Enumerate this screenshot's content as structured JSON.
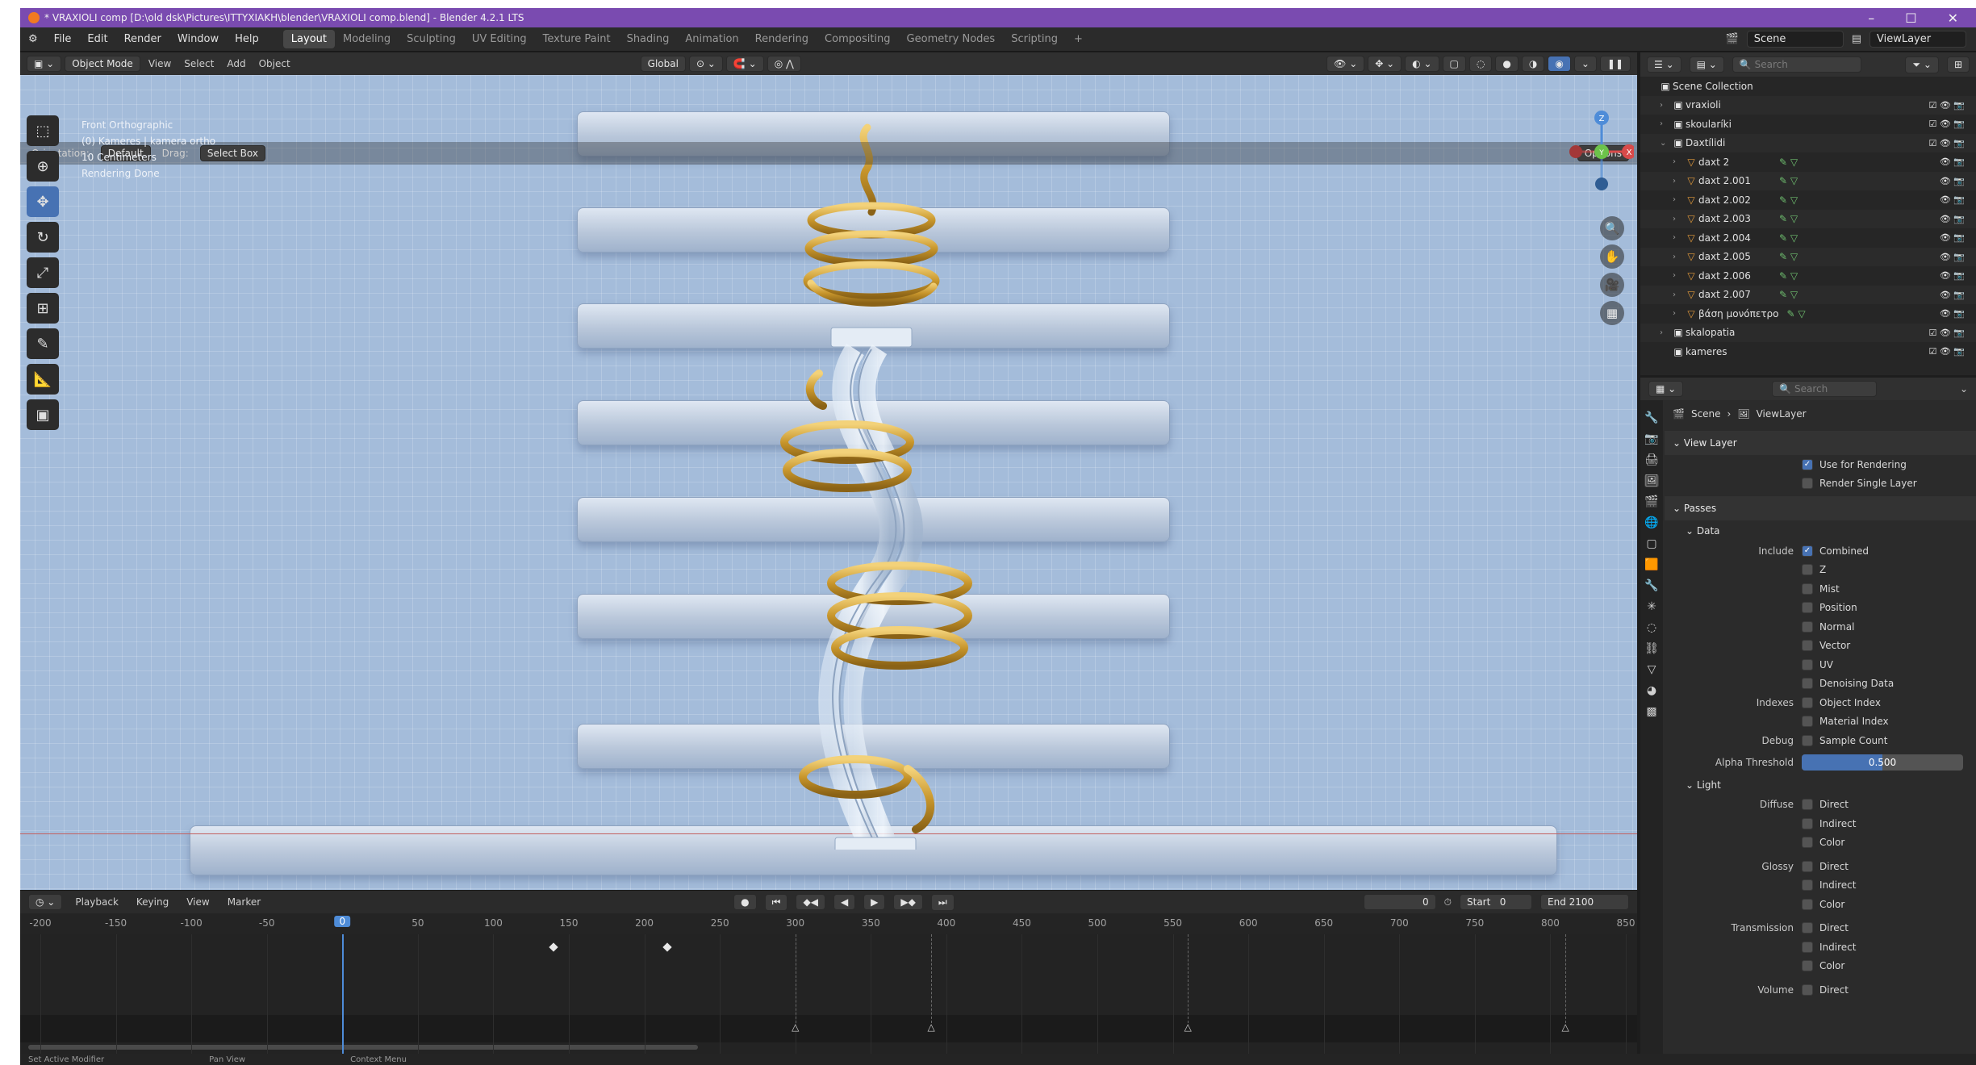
{
  "window": {
    "title": "* VRAXIOLI comp [D:\\old dsk\\Pictures\\ITTYXIAKH\\blender\\VRAXIOLI comp.blend] - Blender 4.2.1 LTS",
    "controls": [
      "–",
      "☐",
      "✕"
    ]
  },
  "menu": [
    "File",
    "Edit",
    "Render",
    "Window",
    "Help"
  ],
  "workspaces": [
    "Layout",
    "Modeling",
    "Sculpting",
    "UV Editing",
    "Texture Paint",
    "Shading",
    "Animation",
    "Rendering",
    "Compositing",
    "Geometry Nodes",
    "Scripting"
  ],
  "active_workspace": "Layout",
  "add_workspace": "+",
  "scene": {
    "label": "Scene",
    "view_layer": "ViewLayer"
  },
  "viewport": {
    "mode": "Object Mode",
    "menus": [
      "View",
      "Select",
      "Add",
      "Object"
    ],
    "transform": "Global",
    "orientation_label": "Orientation:",
    "orientation_value": "Default",
    "drag_label": "Drag:",
    "drag_value": "Select Box",
    "options": "Options",
    "info_lines": [
      "Front Orthographic",
      "(0) Kameres | kamera ortho",
      "10 Centimeters",
      "Rendering Done"
    ]
  },
  "gizmo": {
    "x": "X",
    "y": "Y",
    "z": "Z"
  },
  "timeline": {
    "menus": [
      "Playback",
      "Keying",
      "View",
      "Marker"
    ],
    "current_frame": "0",
    "start_label": "Start",
    "start": "0",
    "end_label": "End",
    "end": "2100",
    "current_frame_value": 0,
    "ticks": [
      "-200",
      "-150",
      "-100",
      "-50",
      "0",
      "50",
      "100",
      "150",
      "200",
      "250",
      "300",
      "350",
      "400",
      "450",
      "500",
      "550",
      "600",
      "650",
      "700",
      "750",
      "800",
      "850"
    ],
    "keyframes": [
      140,
      215
    ],
    "markers": [
      300,
      390,
      560,
      810
    ]
  },
  "statusbar": {
    "items": [
      "Set Active Modifier",
      "Pan View",
      "Context Menu"
    ]
  },
  "outliner": {
    "search_placeholder": "Search",
    "rows": [
      {
        "name": "Scene Collection",
        "level": 0,
        "icon": "collection",
        "expand": ""
      },
      {
        "name": "vraxioli",
        "level": 1,
        "icon": "collection",
        "expand": "›"
      },
      {
        "name": "skoularíki",
        "level": 1,
        "icon": "collection",
        "expand": "›"
      },
      {
        "name": "Daxtílidi",
        "level": 1,
        "icon": "collection",
        "expand": "⌄"
      },
      {
        "name": "daxt 2",
        "level": 2,
        "icon": "mesh",
        "expand": "›"
      },
      {
        "name": "daxt 2.001",
        "level": 2,
        "icon": "mesh",
        "expand": "›"
      },
      {
        "name": "daxt 2.002",
        "level": 2,
        "icon": "mesh",
        "expand": "›"
      },
      {
        "name": "daxt 2.003",
        "level": 2,
        "icon": "mesh",
        "expand": "›"
      },
      {
        "name": "daxt 2.004",
        "level": 2,
        "icon": "mesh",
        "expand": "›"
      },
      {
        "name": "daxt 2.005",
        "level": 2,
        "icon": "mesh",
        "expand": "›"
      },
      {
        "name": "daxt 2.006",
        "level": 2,
        "icon": "mesh",
        "expand": "›"
      },
      {
        "name": "daxt 2.007",
        "level": 2,
        "icon": "mesh",
        "expand": "›"
      },
      {
        "name": "βάση μονόπετρο",
        "level": 2,
        "icon": "mesh",
        "expand": "›"
      },
      {
        "name": "skalopatia",
        "level": 1,
        "icon": "collection",
        "expand": "›"
      },
      {
        "name": "kameres",
        "level": 1,
        "icon": "collection",
        "expand": ""
      }
    ]
  },
  "properties": {
    "search_placeholder": "Search",
    "breadcrumb": [
      "Scene",
      "ViewLayer"
    ],
    "view_layer_section": "View Layer",
    "use_for_rendering": "Use for Rendering",
    "render_single_layer": "Render Single Layer",
    "passes_section": "Passes",
    "data_section": "Data",
    "include_label": "Include",
    "data_passes": [
      {
        "label": "Combined",
        "on": true
      },
      {
        "label": "Z",
        "on": false
      },
      {
        "label": "Mist",
        "on": false
      },
      {
        "label": "Position",
        "on": false
      },
      {
        "label": "Normal",
        "on": false
      },
      {
        "label": "Vector",
        "on": false
      },
      {
        "label": "UV",
        "on": false
      },
      {
        "label": "Denoising Data",
        "on": false
      }
    ],
    "indexes_label": "Indexes",
    "index_passes": [
      "Object Index",
      "Material Index"
    ],
    "debug_label": "Debug",
    "debug_pass": "Sample Count",
    "alpha_label": "Alpha Threshold",
    "alpha_value": "0.500",
    "alpha_fraction": 0.5,
    "light_section": "Light",
    "light_groups": [
      {
        "label": "Diffuse",
        "items": [
          "Direct",
          "Indirect",
          "Color"
        ]
      },
      {
        "label": "Glossy",
        "items": [
          "Direct",
          "Indirect",
          "Color"
        ]
      },
      {
        "label": "Transmission",
        "items": [
          "Direct",
          "Indirect",
          "Color"
        ]
      },
      {
        "label": "Volume",
        "items": [
          "Direct"
        ]
      }
    ]
  }
}
